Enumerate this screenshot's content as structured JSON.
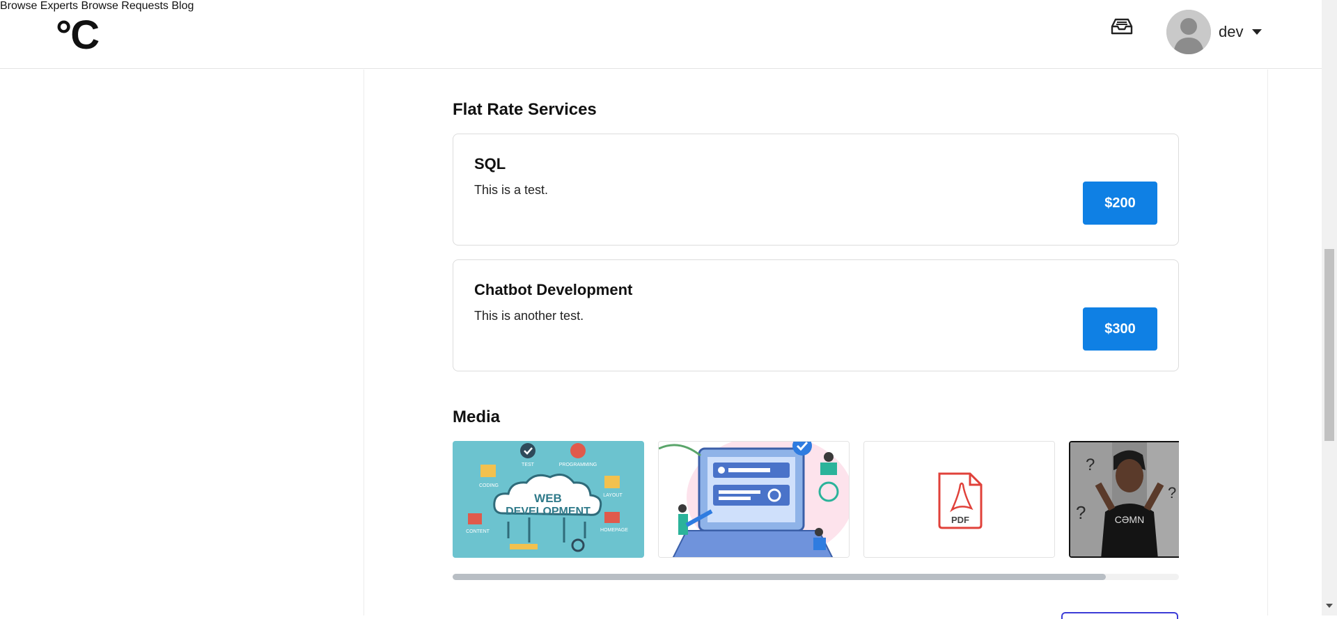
{
  "header": {
    "logo": "°C",
    "nav": {
      "browse_experts": "Browse Experts",
      "browse_requests": "Browse Requests",
      "blog": "Blog"
    },
    "inbox_icon": "inbox-icon",
    "user": {
      "name": "dev",
      "avatar_icon": "user-avatar-icon"
    }
  },
  "flat_rate": {
    "title": "Flat Rate Services",
    "services": [
      {
        "name": "SQL",
        "description": "This is a test.",
        "price": "$200"
      },
      {
        "name": "Chatbot Development",
        "description": "This is another test.",
        "price": "$300"
      }
    ]
  },
  "media": {
    "title": "Media",
    "items": [
      {
        "type": "image",
        "label": "WEB DEVELOPMENT",
        "tags": [
          "TEST",
          "PROGRAMMING",
          "CODING",
          "LAYOUT",
          "CONTENT",
          "HOMEPAGE"
        ]
      },
      {
        "type": "image",
        "label": ""
      },
      {
        "type": "pdf",
        "label": "PDF"
      },
      {
        "type": "video",
        "label": ""
      }
    ]
  },
  "colors": {
    "primary": "#0f80e4",
    "scroll_thumb": "#b8bec4"
  }
}
